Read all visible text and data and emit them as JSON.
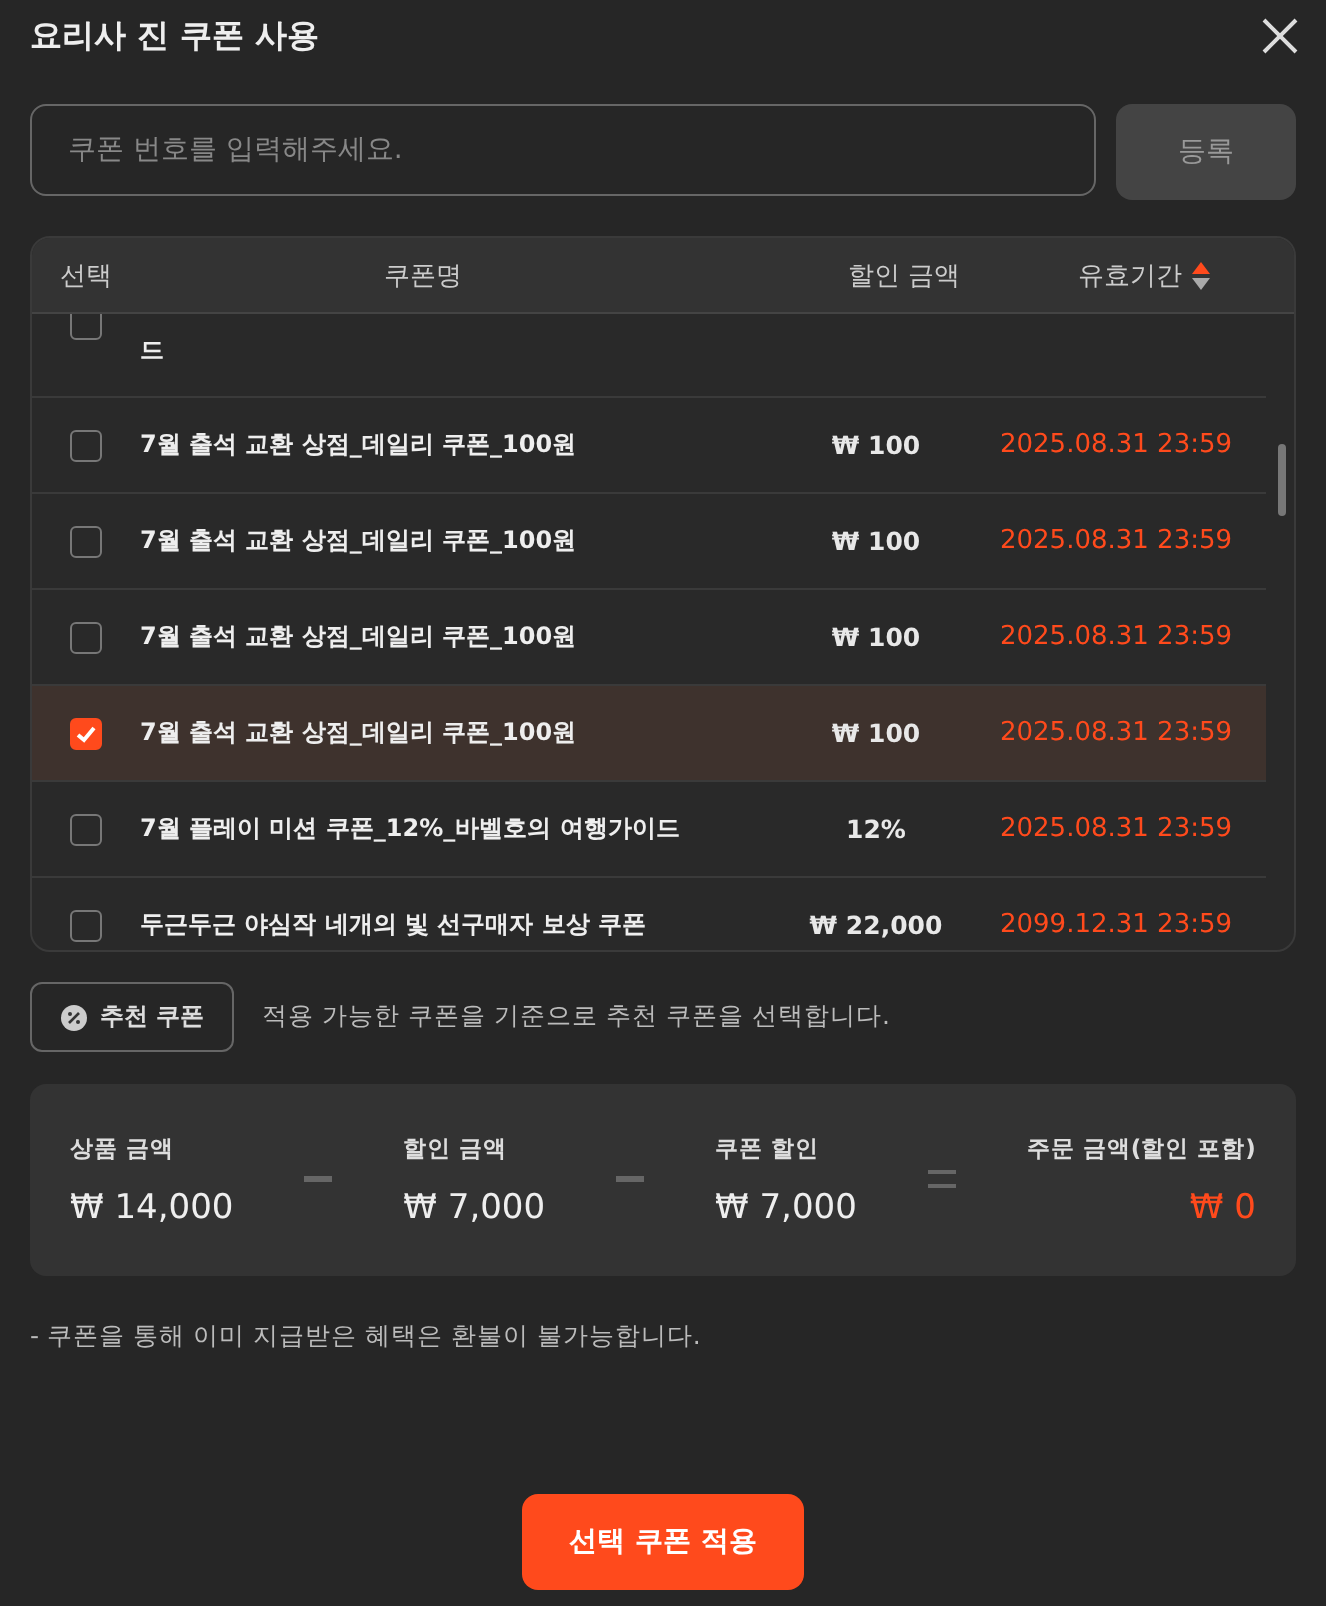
{
  "title": "요리사 진 쿠폰 사용",
  "code_field": {
    "placeholder": "쿠폰 번호를 입력해주세요."
  },
  "register_button": "등록",
  "table": {
    "columns": [
      "선택",
      "쿠폰명",
      "할인 금액",
      "유효기간"
    ],
    "rows": [
      {
        "kind": "partial",
        "name": "드",
        "checked": false
      },
      {
        "kind": "full",
        "name": "7월 출석 교환 상점_데일리 쿠폰_100원",
        "amount": "₩ 100",
        "expiry": "2025.08.31 23:59",
        "checked": false
      },
      {
        "kind": "full",
        "name": "7월 출석 교환 상점_데일리 쿠폰_100원",
        "amount": "₩ 100",
        "expiry": "2025.08.31 23:59",
        "checked": false
      },
      {
        "kind": "full",
        "name": "7월 출석 교환 상점_데일리 쿠폰_100원",
        "amount": "₩ 100",
        "expiry": "2025.08.31 23:59",
        "checked": false
      },
      {
        "kind": "full",
        "name": "7월 출석 교환 상점_데일리 쿠폰_100원",
        "amount": "₩ 100",
        "expiry": "2025.08.31 23:59",
        "checked": true
      },
      {
        "kind": "full",
        "name": "7월 플레이 미션 쿠폰_12%_바벨호의 여행가이드",
        "amount": "12%",
        "expiry": "2025.08.31 23:59",
        "checked": false
      },
      {
        "kind": "full",
        "name": "두근두근 야심작 네개의 빛 선구매자 보상 쿠폰",
        "amount": "₩ 22,000",
        "expiry": "2099.12.31 23:59",
        "checked": false
      }
    ]
  },
  "recommend_button": "추천 쿠폰",
  "recommend_note": "적용 가능한 쿠폰을 기준으로 추천 쿠폰을 선택합니다.",
  "summary": [
    {
      "kind": "minus",
      "label": "상품 금액",
      "value": "₩ 14,000"
    },
    {
      "kind": "minus",
      "label": "할인 금액",
      "value": "₩ 7,000"
    },
    {
      "kind": "equals",
      "label": "쿠폰 할인",
      "value": "₩ 7,000"
    },
    {
      "kind": "total",
      "label": "주문 금액(할인 포함)",
      "value": "₩ 0"
    }
  ],
  "notice": "- 쿠폰을 통해 이미 지급받은 혜택은 환불이 불가능합니다.",
  "apply_button": "선택 쿠폰 적용"
}
